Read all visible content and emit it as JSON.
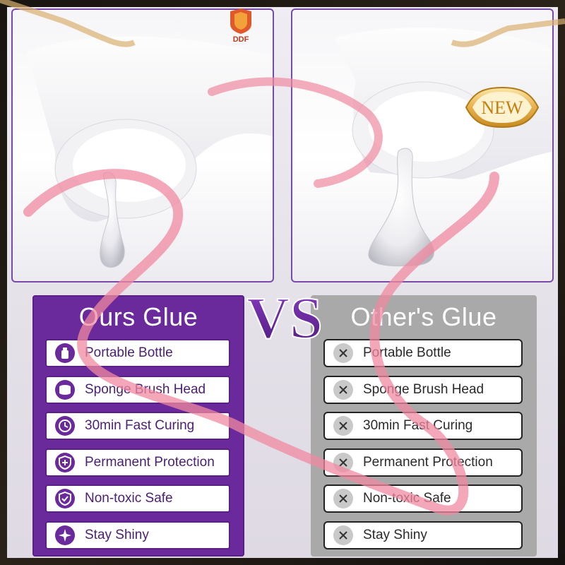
{
  "logo": {
    "text": "DDF"
  },
  "badge": {
    "text": "NEW"
  },
  "vs": {
    "text": "VS"
  },
  "ours": {
    "title": "Ours Glue",
    "items": [
      {
        "label": "Portable Bottle",
        "icon": "bottle-icon"
      },
      {
        "label": "Sponge Brush Head",
        "icon": "sponge-icon"
      },
      {
        "label": "30min Fast Curing",
        "icon": "timer-icon"
      },
      {
        "label": "Permanent Protection",
        "icon": "shield-plus-icon"
      },
      {
        "label": "Non-toxic Safe",
        "icon": "shield-check-icon"
      },
      {
        "label": "Stay Shiny",
        "icon": "sparkle-icon"
      }
    ]
  },
  "other": {
    "title": "Other's Glue",
    "items": [
      {
        "label": "Portable Bottle",
        "icon": "x-icon"
      },
      {
        "label": "Sponge Brush Head",
        "icon": "x-icon"
      },
      {
        "label": "30min Fast Curing",
        "icon": "x-icon"
      },
      {
        "label": "Permanent Protection",
        "icon": "x-icon"
      },
      {
        "label": "Non-toxic Safe",
        "icon": "x-icon"
      },
      {
        "label": "Stay Shiny",
        "icon": "x-icon"
      }
    ]
  },
  "colors": {
    "ours_bg": "#6b2a9c",
    "other_bg": "#a9a9a9",
    "ribbon": "#f08aa0",
    "badge_gold": "#e8b04a"
  }
}
